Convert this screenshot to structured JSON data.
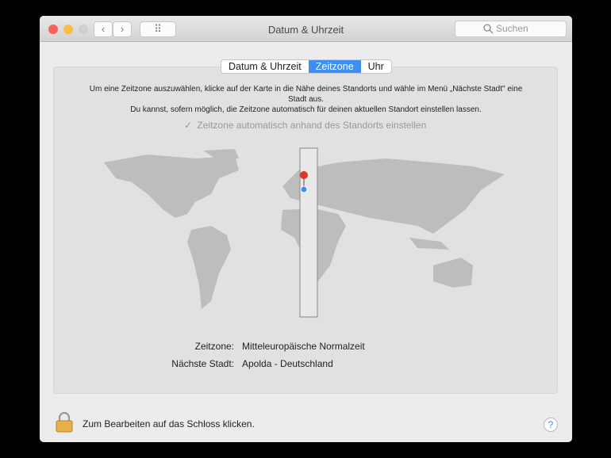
{
  "window": {
    "title": "Datum & Uhrzeit",
    "search_placeholder": "Suchen",
    "back": "‹",
    "forward": "›",
    "grid": "⠿"
  },
  "tabs": [
    {
      "label": "Datum & Uhrzeit"
    },
    {
      "label": "Zeitzone",
      "selected": true
    },
    {
      "label": "Uhr"
    }
  ],
  "instructions": {
    "line1": "Um eine Zeitzone auszuwählen, klicke auf der Karte in die Nähe deines Standorts und wähle im Menü „Nächste Stadt\" eine",
    "line2": "Stadt aus.",
    "line3": "Du kannst, sofern möglich, die Zeitzone automatisch für deinen aktuellen Standort einstellen lassen."
  },
  "auto_checkbox": {
    "label": "Zeitzone automatisch anhand des Standorts einstellen",
    "checked": true,
    "check": "✓"
  },
  "timezone": {
    "label": "Zeitzone:",
    "value": "Mitteleuropäische Normalzeit"
  },
  "city": {
    "label": "Nächste Stadt:",
    "value": "Apolda - Deutschland"
  },
  "footer": {
    "lock_text": "Zum Bearbeiten auf das Schloss klicken.",
    "help": "?"
  },
  "colors": {
    "accent": "#3d8ef5",
    "close": "#fc605b",
    "minimize": "#fdbc40"
  }
}
